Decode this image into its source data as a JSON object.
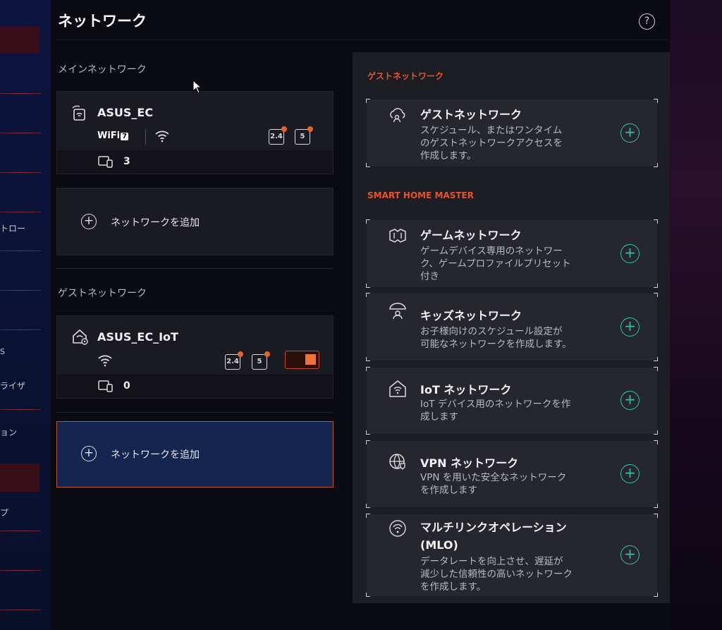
{
  "header": {
    "title": "ネットワーク",
    "help_icon": "?"
  },
  "sidebar": {
    "fragments": [
      "トロー",
      "ライザ",
      "ョン",
      "プ",
      "S"
    ]
  },
  "main_network": {
    "section_label": "メインネットワーク",
    "ssid": "ASUS_EC",
    "wifi_badge": "WiFi",
    "wifi_badge_version": "7",
    "bands": [
      "2.4",
      "5"
    ],
    "device_count": "3"
  },
  "add_network_main": {
    "label": "ネットワークを追加"
  },
  "guest_network": {
    "section_label": "ゲストネットワーク",
    "ssid": "ASUS_EC_IoT",
    "bands": [
      "2.4",
      "5"
    ],
    "device_count": "0",
    "toggle_on": true
  },
  "add_network_guest": {
    "label": "ネットワークを追加"
  },
  "right_panel": {
    "guest_section_label": "ゲストネットワーク",
    "smart_home_section_label": "SMART HOME MASTER",
    "options": [
      {
        "title": "ゲストネットワーク",
        "desc": [
          "スケジュール、またはワンタイム",
          "のゲストネットワークアクセスを",
          "作成します。"
        ]
      },
      {
        "title": "ゲームネットワーク",
        "desc": [
          "ゲームデバイス専用のネットワー",
          "ク、ゲームプロファイルプリセット",
          "付き"
        ]
      },
      {
        "title": "キッズネットワーク",
        "desc": [
          "お子様向けのスケジュール設定が",
          "可能なネットワークを作成します。"
        ]
      },
      {
        "title": "IoT ネットワーク",
        "desc": [
          "IoT デバイス用のネットワークを作",
          "成します"
        ]
      },
      {
        "title": "VPN ネットワーク",
        "desc": [
          "VPN を用いた安全なネットワーク",
          "を作成します"
        ]
      },
      {
        "title": "マルチリンクオペレーション",
        "title2": "(MLO)",
        "desc": [
          "データレートを向上させ、遅延が",
          "減少した信頼性の高いネットワーク",
          "を作成します。"
        ]
      }
    ],
    "add_symbol": "+"
  },
  "colors": {
    "accent": "#e5542a",
    "add_icon": "#2ec4a2",
    "toggle": "#f07238"
  }
}
